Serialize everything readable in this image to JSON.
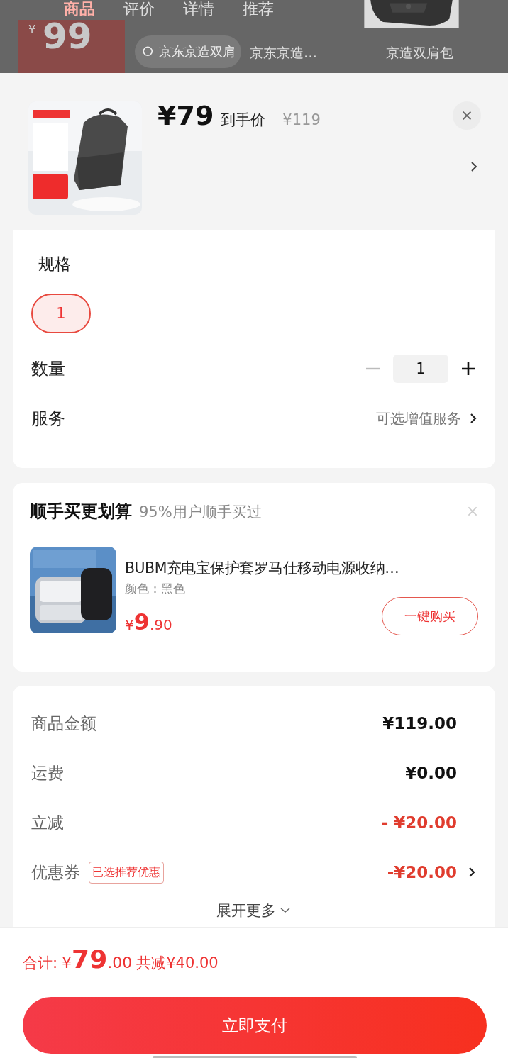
{
  "background": {
    "tabs": [
      {
        "label": "商品",
        "selected": true
      },
      {
        "label": "评价",
        "selected": false
      },
      {
        "label": "详情",
        "selected": false
      },
      {
        "label": "推荐",
        "selected": false
      }
    ],
    "search": {
      "value": "京东京造双肩"
    },
    "suggestions": [
      "京东京造…",
      "京造双肩包"
    ],
    "badge_price": "99",
    "badge_currency": "¥"
  },
  "product": {
    "kind": "picture",
    "price": "¥79",
    "price_label": "到手价",
    "original_price": "¥119"
  },
  "spec": {
    "title": "规格",
    "options": [
      {
        "label": "1",
        "selected": true
      }
    ]
  },
  "quantity": {
    "label": "数量",
    "value": "1",
    "minus_disabled": true
  },
  "service": {
    "label": "服务",
    "value": "可选增值服务"
  },
  "addon": {
    "title": "顺手买更划算",
    "subtitle": "95%用户顺手买过",
    "item": {
      "kind": "picture",
      "name": "BUBM充电宝保护套罗马仕移动电源收纳…",
      "attr": "颜色：黑色",
      "currency": "¥",
      "price_int": "9",
      "price_dec": ".90",
      "button": "一键购买"
    }
  },
  "summary": {
    "rows": [
      {
        "label": "商品金额",
        "value": "¥119.00",
        "kind": "plain"
      },
      {
        "label": "运费",
        "value": "¥0.00",
        "kind": "plain"
      },
      {
        "label": "立减",
        "value": "- ¥20.00",
        "kind": "discount"
      },
      {
        "label": "优惠券",
        "tag": "已选推荐优惠",
        "value": "-¥20.00",
        "kind": "coupon"
      }
    ],
    "more": "展开更多"
  },
  "footer": {
    "total_label": "合计:",
    "currency": "¥",
    "total_int": "79",
    "total_dec": ".00",
    "saved": "共减¥40.00",
    "pay_button": "立即支付"
  }
}
